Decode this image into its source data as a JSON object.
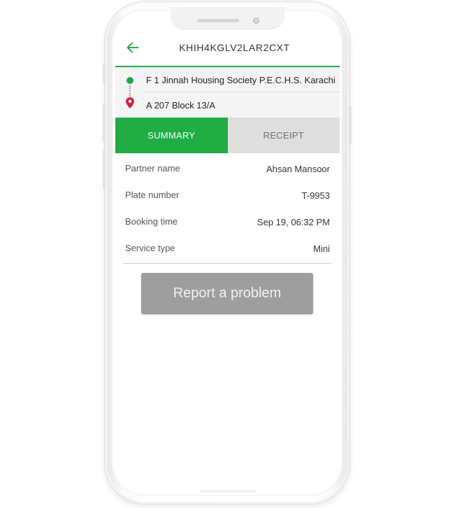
{
  "header": {
    "title": "KHIH4KGLV2LAR2CXT",
    "back_icon": "arrow-left-icon",
    "accent_color": "#2aa84a"
  },
  "route": {
    "pickup": "F 1  Jinnah Housing Society P.E.C.H.S. Karachi",
    "dropoff": "A 207  Block 13/A",
    "pickup_icon": "green-dot-icon",
    "dropoff_icon": "red-pin-icon"
  },
  "tabs": [
    {
      "label": "SUMMARY",
      "active": true
    },
    {
      "label": "RECEIPT",
      "active": false
    }
  ],
  "details": [
    {
      "label": "Partner name",
      "value": "Ahsan Mansoor"
    },
    {
      "label": "Plate number",
      "value": "T-9953"
    },
    {
      "label": "Booking time",
      "value": "Sep 19, 06:32 PM"
    },
    {
      "label": "Service type",
      "value": "Mini"
    }
  ],
  "actions": {
    "report_label": "Report a problem"
  },
  "colors": {
    "active_tab": "#1fad44",
    "inactive_tab": "#dedede",
    "report_button": "#9e9e9e",
    "pin_red": "#d4213d"
  }
}
